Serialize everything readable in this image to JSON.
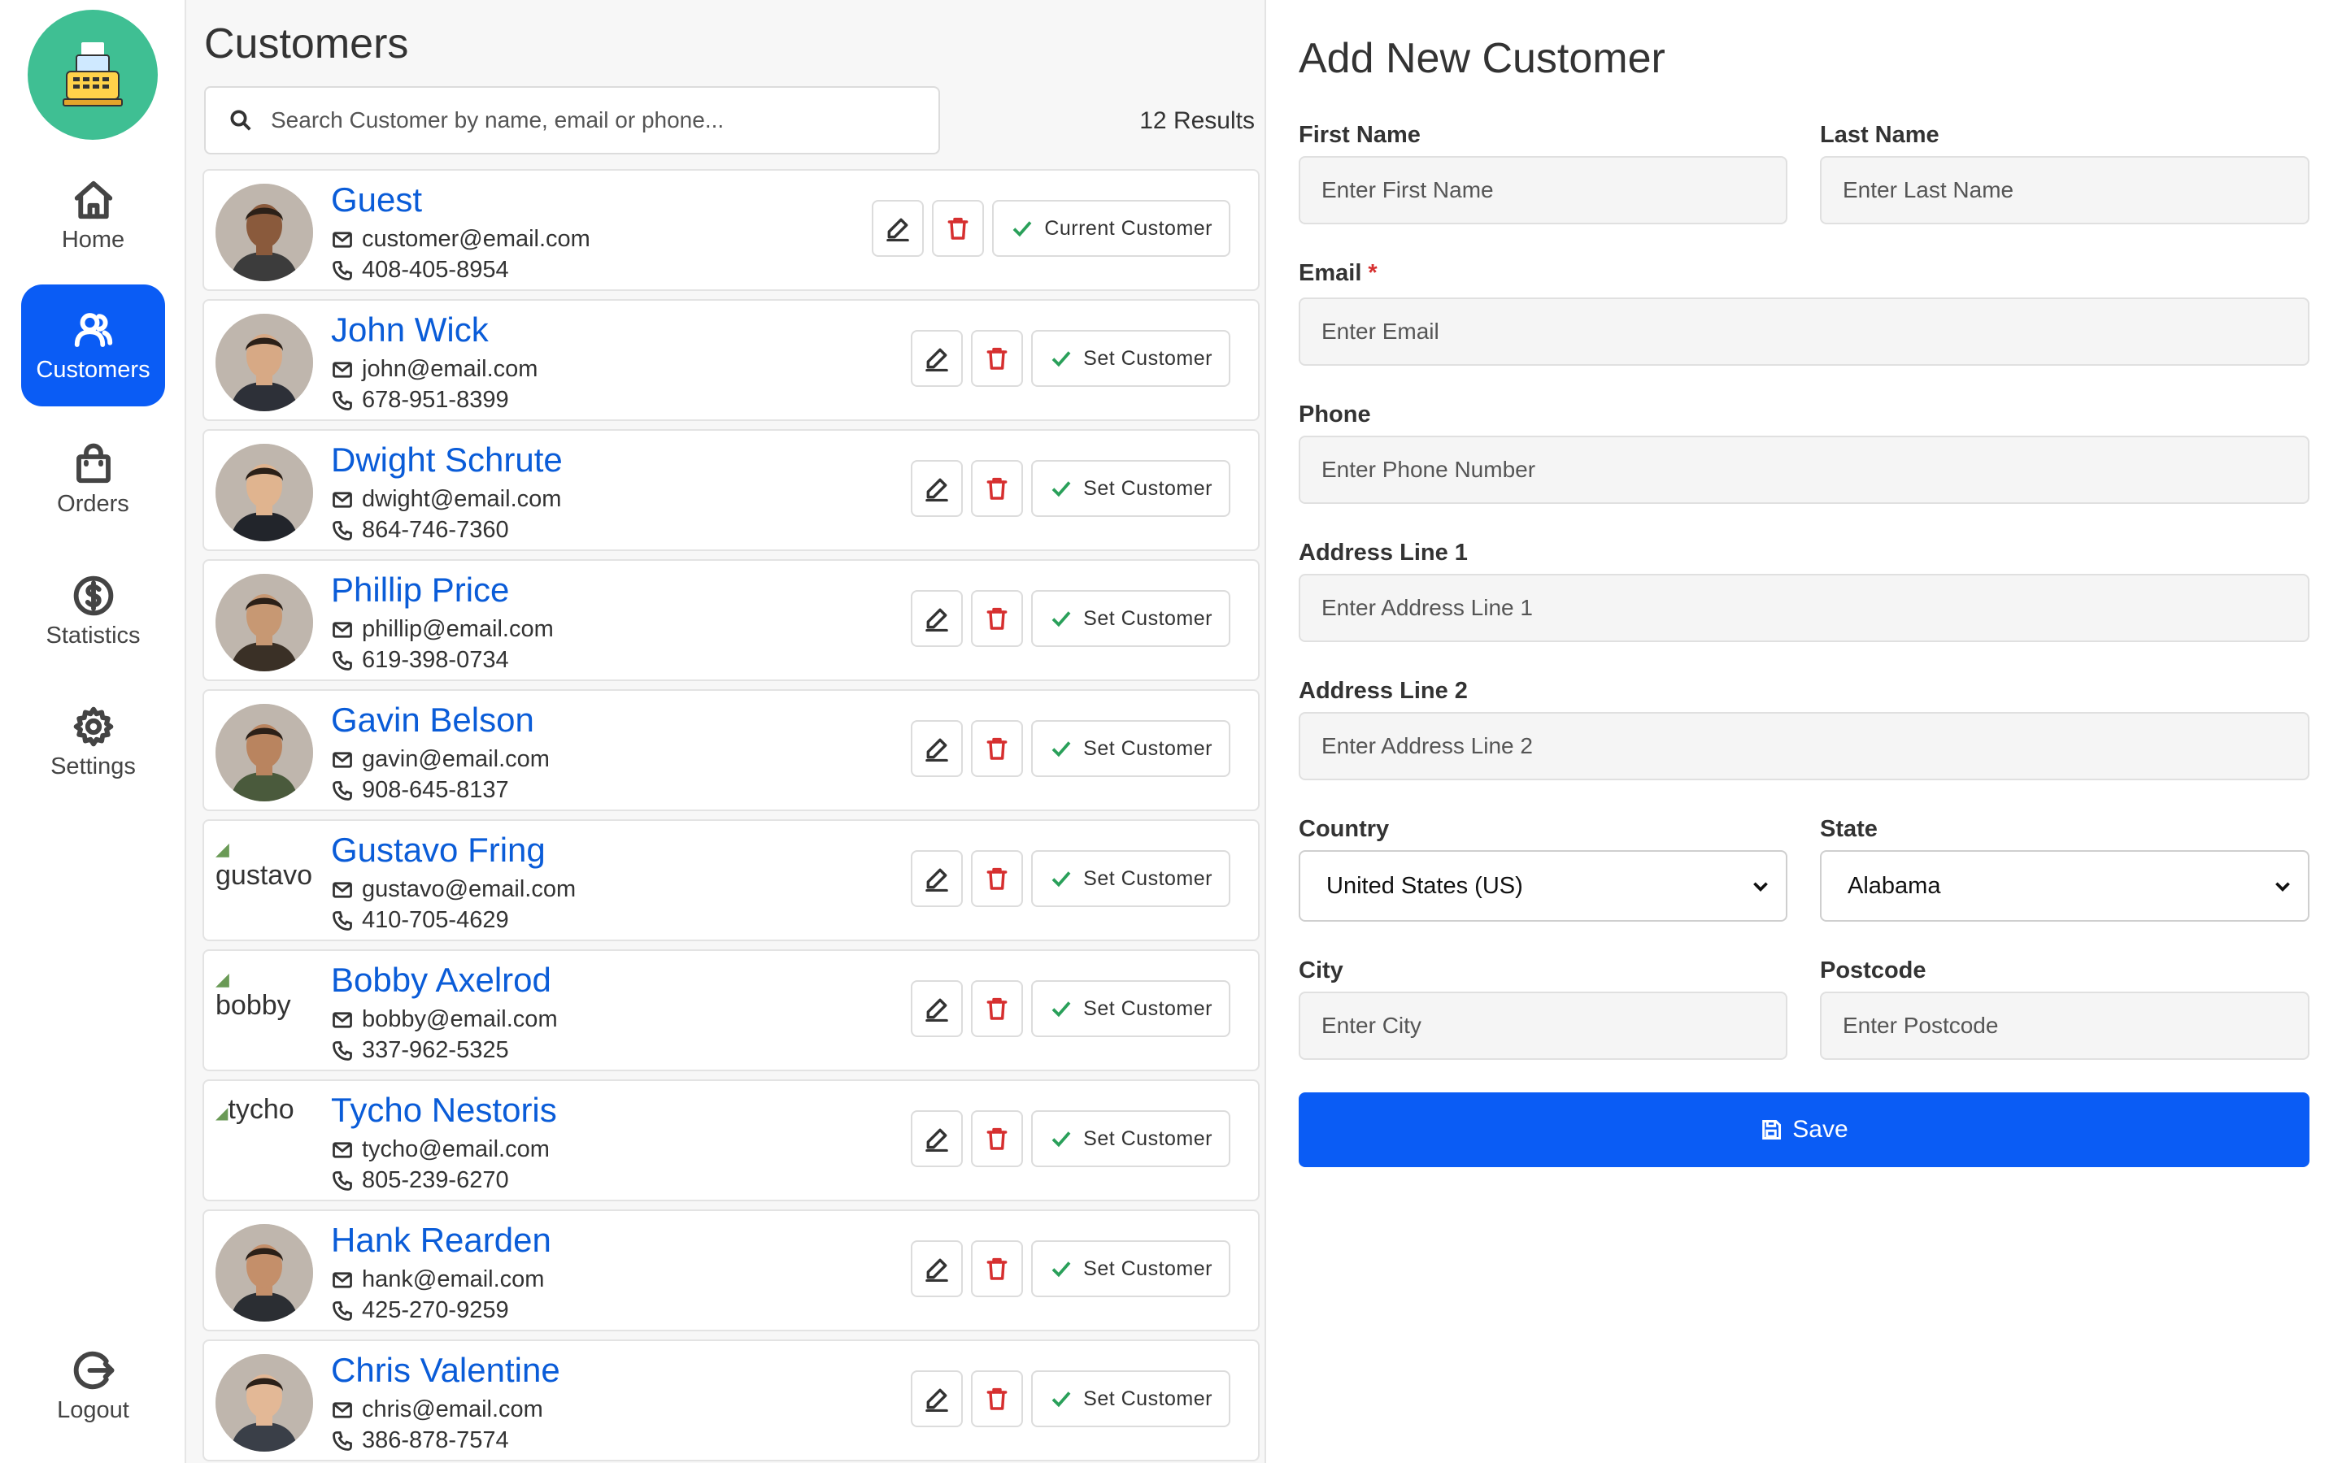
{
  "sidebar": {
    "logo_icon": "cash-register-icon",
    "items": [
      {
        "label": "Home",
        "icon": "home-icon",
        "active": false
      },
      {
        "label": "Customers",
        "icon": "customers-icon",
        "active": true
      },
      {
        "label": "Orders",
        "icon": "shopping-bag-icon",
        "active": false
      },
      {
        "label": "Statistics",
        "icon": "dollar-circle-icon",
        "active": false
      },
      {
        "label": "Settings",
        "icon": "gear-icon",
        "active": false
      }
    ],
    "logout_label": "Logout"
  },
  "customers": {
    "title": "Customers",
    "search_placeholder": "Search Customer by name, email or phone...",
    "results": "12 Results",
    "set_label": "Set Customer",
    "current_label": "Current Customer",
    "list": [
      {
        "name": "Guest",
        "email": "customer@email.com",
        "phone": "408-405-8954",
        "current": true,
        "avatar": "photo"
      },
      {
        "name": "John Wick",
        "email": "john@email.com",
        "phone": "678-951-8399",
        "current": false,
        "avatar": "photo"
      },
      {
        "name": "Dwight Schrute",
        "email": "dwight@email.com",
        "phone": "864-746-7360",
        "current": false,
        "avatar": "photo"
      },
      {
        "name": "Phillip Price",
        "email": "phillip@email.com",
        "phone": "619-398-0734",
        "current": false,
        "avatar": "photo"
      },
      {
        "name": "Gavin Belson",
        "email": "gavin@email.com",
        "phone": "908-645-8137",
        "current": false,
        "avatar": "photo"
      },
      {
        "name": "Gustavo Fring",
        "email": "gustavo@email.com",
        "phone": "410-705-4629",
        "current": false,
        "avatar": "broken",
        "alt": "gustavo"
      },
      {
        "name": "Bobby Axelrod",
        "email": "bobby@email.com",
        "phone": "337-962-5325",
        "current": false,
        "avatar": "broken",
        "alt": "bobby"
      },
      {
        "name": "Tycho Nestoris",
        "email": "tycho@email.com",
        "phone": "805-239-6270",
        "current": false,
        "avatar": "broken-inline",
        "alt": "tycho"
      },
      {
        "name": "Hank Rearden",
        "email": "hank@email.com",
        "phone": "425-270-9259",
        "current": false,
        "avatar": "photo"
      },
      {
        "name": "Chris Valentine",
        "email": "chris@email.com",
        "phone": "386-878-7574",
        "current": false,
        "avatar": "photo"
      }
    ]
  },
  "form": {
    "title": "Add New Customer",
    "first_name": {
      "label": "First Name",
      "placeholder": "Enter First Name"
    },
    "last_name": {
      "label": "Last Name",
      "placeholder": "Enter Last Name"
    },
    "email": {
      "label": "Email",
      "required_mark": "*",
      "placeholder": "Enter Email"
    },
    "phone": {
      "label": "Phone",
      "placeholder": "Enter Phone Number"
    },
    "address1": {
      "label": "Address Line 1",
      "placeholder": "Enter Address Line 1"
    },
    "address2": {
      "label": "Address Line 2",
      "placeholder": "Enter Address Line 2"
    },
    "country": {
      "label": "Country",
      "value": "United States (US)"
    },
    "state": {
      "label": "State",
      "value": "Alabama"
    },
    "city": {
      "label": "City",
      "placeholder": "Enter City"
    },
    "postcode": {
      "label": "Postcode",
      "placeholder": "Enter Postcode"
    },
    "save_label": "Save"
  },
  "colors": {
    "accent": "#0a5cf5",
    "link": "#0a5cd8",
    "logo_bg": "#3fbf93",
    "danger": "#d62f2f",
    "success": "#2aa05a"
  }
}
